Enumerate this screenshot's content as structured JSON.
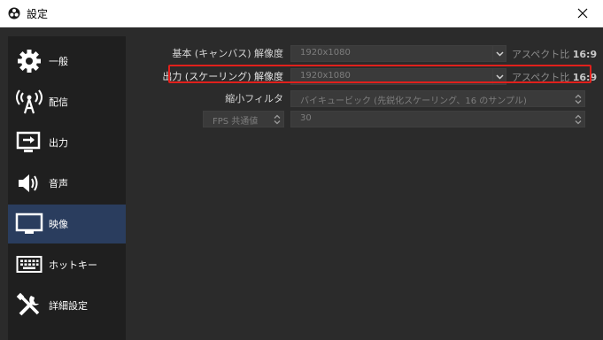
{
  "window": {
    "title": "設定",
    "icon": "obs-logo-icon",
    "close_icon": "close-icon"
  },
  "sidebar": {
    "items": [
      {
        "label": "一般",
        "icon": "gear-icon"
      },
      {
        "label": "配信",
        "icon": "antenna-icon"
      },
      {
        "label": "出力",
        "icon": "output-icon"
      },
      {
        "label": "音声",
        "icon": "speaker-icon"
      },
      {
        "label": "映像",
        "icon": "monitor-icon",
        "active": true
      },
      {
        "label": "ホットキー",
        "icon": "keyboard-icon"
      },
      {
        "label": "詳細設定",
        "icon": "tools-icon"
      }
    ]
  },
  "video": {
    "base_resolution": {
      "label": "基本 (キャンバス) 解像度",
      "value": "1920x1080",
      "aspect_prefix": "アスペクト比",
      "aspect_value": "16:9"
    },
    "output_resolution": {
      "label": "出力 (スケーリング) 解像度",
      "value": "1920x1080",
      "aspect_prefix": "アスペクト比",
      "aspect_value": "16:9"
    },
    "downscale_filter": {
      "label": "縮小フィルタ",
      "value": "バイキュービック (先鋭化スケーリング、16 のサンプル)"
    },
    "fps": {
      "label": "FPS 共通値",
      "value": "30"
    }
  },
  "colors": {
    "highlight": "#e0201c",
    "active_item": "#2a3d5e",
    "panel": "#2b2b2b"
  }
}
